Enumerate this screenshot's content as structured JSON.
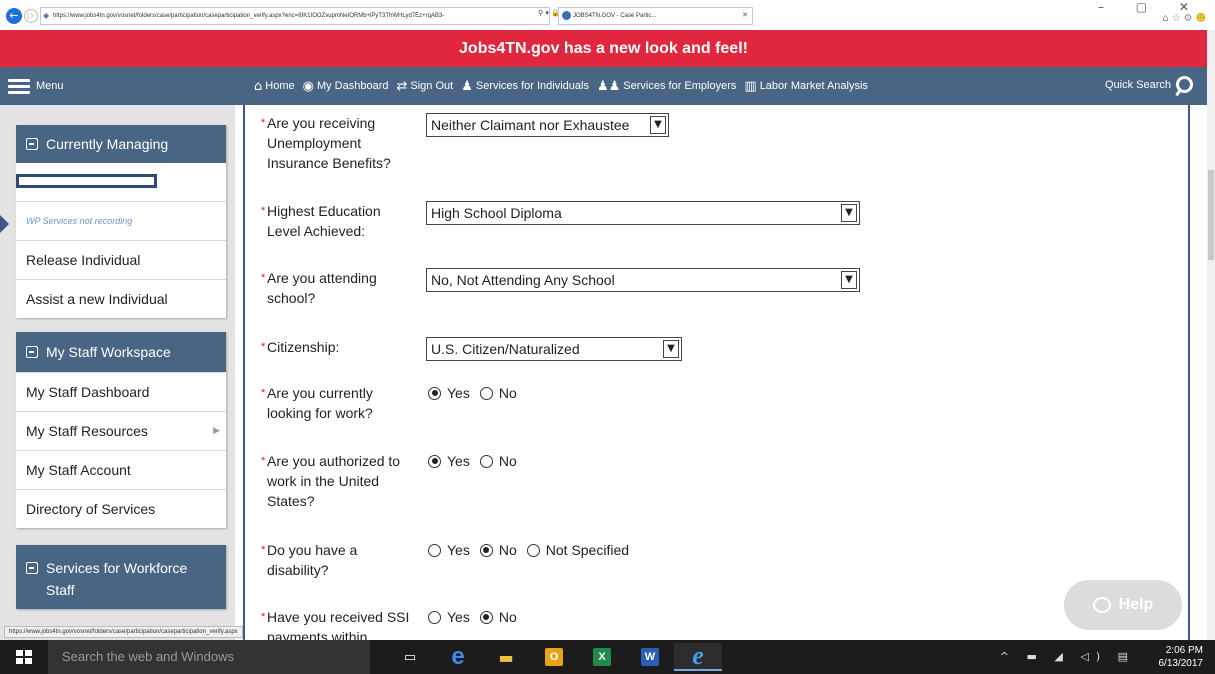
{
  "browser": {
    "url": "https://www.jobs4tn.gov/vosnet/folders/case/participation/caseparticipation_verify.aspx?enc=8IK1IOOZvupmNeIORMb+lPyT3ThWHLyd7Ez+rqAB3-",
    "tab_title": "JOBS4TN.GOV - Case Partic...",
    "back_glyph": "←",
    "forward_glyph": "▷",
    "address_icons": "⚲ ▾ 🔒 C",
    "window_controls": "– ▢ ✕",
    "tools_home": "⌂",
    "tools_star": "☆",
    "tools_gear": "⚙",
    "tools_smile": "☻",
    "tab_close": "✕"
  },
  "banner": {
    "text": "Jobs4TN.gov has a new look and feel!",
    "color": "#e0273d"
  },
  "navbar": {
    "menu_label": "Menu",
    "links": [
      {
        "icon": "⌂",
        "label": "Home"
      },
      {
        "icon": "◉",
        "label": "My Dashboard"
      },
      {
        "icon": "⇄",
        "label": "Sign Out"
      },
      {
        "icon": "♟",
        "label": "Services for Individuals"
      },
      {
        "icon": "♟♟",
        "label": "Services for Employers"
      },
      {
        "icon": "▥",
        "label": "Labor Market Analysis"
      }
    ],
    "quick_search_label": "Quick Search",
    "color": "#486583"
  },
  "sidebar": {
    "currently_managing": {
      "title": "Currently Managing",
      "wp_note": "WP Services not recording",
      "items": [
        "Release Individual",
        "Assist a new Individual"
      ]
    },
    "staff_workspace": {
      "title": "My Staff Workspace",
      "items": [
        "My Staff Dashboard",
        "My Staff Resources",
        "My Staff Account",
        "Directory of Services"
      ],
      "submenu_arrow": "▶"
    },
    "workforce": {
      "title": "Services for Workforce Staff"
    }
  },
  "form": {
    "required_marker": "*",
    "select_arrow": "▼",
    "ui_benefits": {
      "label": "Are you receiving Unemployment Insurance Benefits?",
      "value": "Neither Claimant nor Exhaustee"
    },
    "education": {
      "label": "Highest Education Level Achieved:",
      "value": "High School Diploma"
    },
    "school": {
      "label": "Are you attending school?",
      "value": "No, Not Attending Any School"
    },
    "citizenship": {
      "label": "Citizenship:",
      "value": "U.S. Citizen/Naturalized"
    },
    "looking_for_work": {
      "label": "Are you currently looking for work?",
      "options": [
        "Yes",
        "No"
      ],
      "selected": "Yes"
    },
    "authorized": {
      "label": "Are you authorized to work in the United States?",
      "options": [
        "Yes",
        "No"
      ],
      "selected": "Yes"
    },
    "disability": {
      "label": "Do you have a disability?",
      "options": [
        "Yes",
        "No",
        "Not Specified"
      ],
      "selected": "No"
    },
    "ssi": {
      "label": "Have you received SSI payments within",
      "options": [
        "Yes",
        "No"
      ],
      "selected": "No"
    }
  },
  "help_button": {
    "label": "Help"
  },
  "status_url": "https://www.jobs4tn.gov/vosnet/folders/case/participation/caseparticipation_verify.aspx",
  "taskbar": {
    "search_placeholder": "Search the web and Windows",
    "task_view_glyph": "▭",
    "edge_glyph": "e",
    "explorer_glyph": "▬",
    "outlook_glyph": "O",
    "excel_glyph": "X",
    "word_glyph": "W",
    "ie_glyph": "e",
    "tray_icons": "^ ▬ ◢ ◁) ▤",
    "time": "2:06 PM",
    "date": "6/13/2017"
  }
}
